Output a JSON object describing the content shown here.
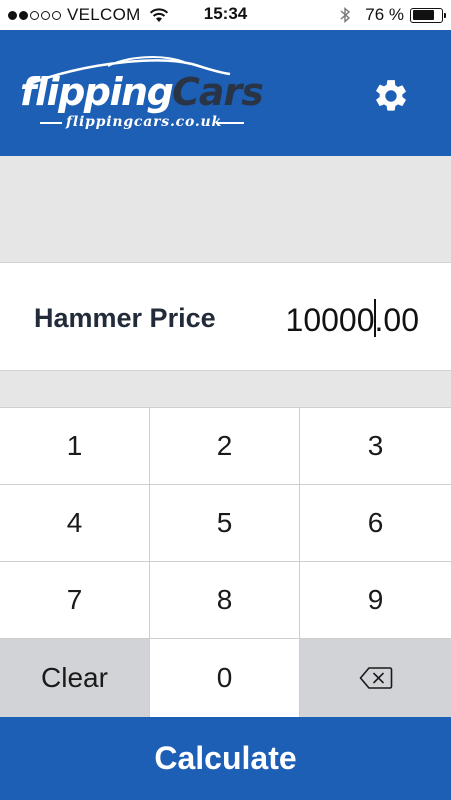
{
  "status_bar": {
    "signal_dots_filled": 2,
    "signal_dots_total": 5,
    "carrier": "VELCOM",
    "time": "15:34",
    "battery_percent": "76 %",
    "battery_level": 0.76,
    "icons": [
      "wifi-icon",
      "bluetooth-icon",
      "battery-icon"
    ]
  },
  "header": {
    "logo_word_1": "flipping",
    "logo_word_2": "Cars",
    "logo_url": "flippingcars.co.uk",
    "background_color": "#1d5fb4",
    "settings_icon": "gear-icon"
  },
  "price": {
    "label": "Hammer Price",
    "value_before_cursor": "10000",
    "value_after_cursor": ".00"
  },
  "keypad": {
    "keys": [
      "1",
      "2",
      "3",
      "4",
      "5",
      "6",
      "7",
      "8",
      "9",
      "Clear",
      "0"
    ],
    "backspace_icon": "backspace-icon"
  },
  "actions": {
    "calculate_label": "Calculate",
    "accent_color": "#1d5fb4"
  }
}
